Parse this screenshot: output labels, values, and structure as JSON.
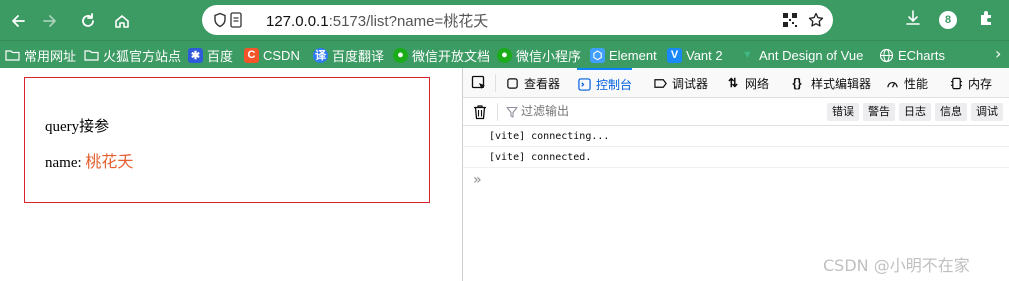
{
  "browser": {
    "url_host": "127.0.0.1",
    "url_rest": ":5173/list?name=桃花夭",
    "notification_count": "8"
  },
  "bookmarks": [
    {
      "label": "常用网址",
      "icon": "folder-icon"
    },
    {
      "label": "火狐官方站点",
      "icon": "folder-icon"
    },
    {
      "label": "百度",
      "icon": "baidu-icon"
    },
    {
      "label": "CSDN",
      "icon": "csdn-icon"
    },
    {
      "label": "百度翻译",
      "icon": "translate-icon"
    },
    {
      "label": "微信开放文档",
      "icon": "wechat-icon"
    },
    {
      "label": "微信小程序",
      "icon": "wechat-icon"
    },
    {
      "label": "Element",
      "icon": "element-icon"
    },
    {
      "label": "Vant 2",
      "icon": "vant-icon"
    },
    {
      "label": "Ant Design of Vue",
      "icon": "vue-icon"
    },
    {
      "label": "ECharts",
      "icon": "globe-icon"
    }
  ],
  "page": {
    "title": "query接参",
    "name_label": "name:",
    "name_value": "桃花夭"
  },
  "devtools": {
    "tabs": [
      {
        "label": "查看器",
        "icon": "inspector-icon"
      },
      {
        "label": "控制台",
        "icon": "console-icon",
        "active": true
      },
      {
        "label": "调试器",
        "icon": "debugger-icon"
      },
      {
        "label": "网络",
        "icon": "network-icon"
      },
      {
        "label": "样式编辑器",
        "icon": "style-editor-icon"
      },
      {
        "label": "性能",
        "icon": "performance-icon"
      },
      {
        "label": "内存",
        "icon": "memory-icon"
      }
    ],
    "filter_placeholder": "过滤输出",
    "levels": [
      "错误",
      "警告",
      "日志",
      "信息",
      "调试"
    ],
    "logs": [
      "[vite] connecting...",
      "[vite] connected."
    ],
    "prompt": "»"
  },
  "watermark": "CSDN @小明不在家",
  "colors": {
    "toolbar": "#3c9a63",
    "active_tab": "#0060df",
    "box_border": "#d9232e",
    "name_value": "#e4602f"
  }
}
